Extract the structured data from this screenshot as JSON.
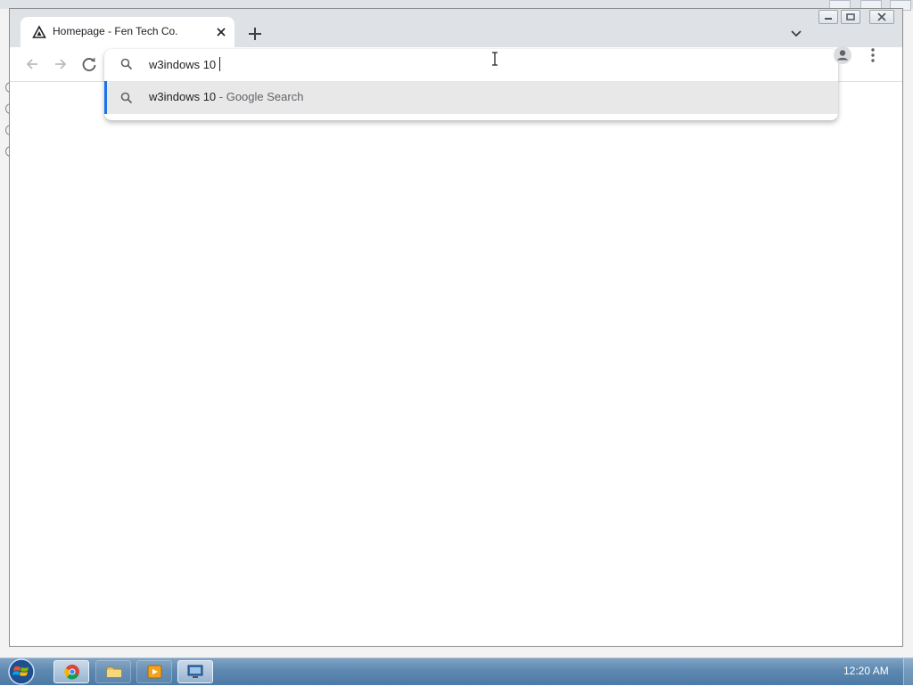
{
  "tab": {
    "title": "Homepage - Fen Tech Co.",
    "favicon": "triangle-logo-icon",
    "close_icon": "close-icon"
  },
  "new_tab_icon": "plus-icon",
  "omnibox": {
    "typed_text": "w3indows 10",
    "suggestion": {
      "query": "w3indows 10",
      "suffix": " - Google Search",
      "icon": "search-icon"
    },
    "accent_color": "#1a73e8"
  },
  "taskbar": {
    "clock": "12:20 AM",
    "items": [
      "chrome-icon",
      "file-explorer-icon",
      "media-player-icon",
      "remote-desktop-icon"
    ]
  }
}
